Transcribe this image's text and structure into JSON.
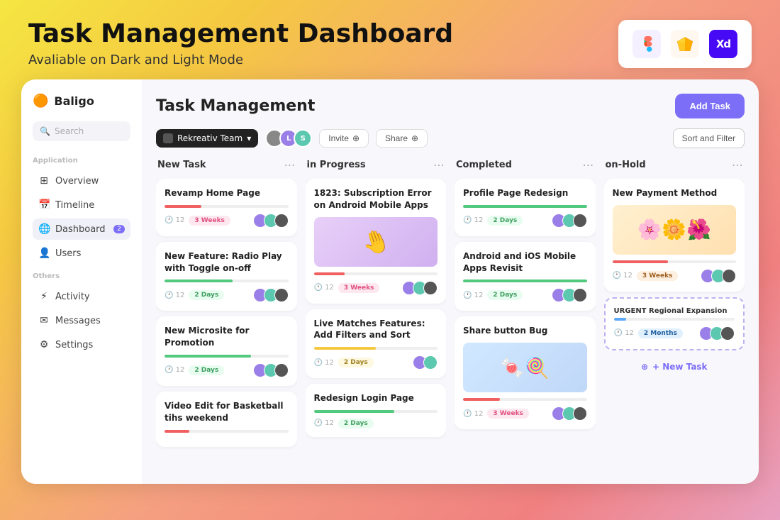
{
  "page": {
    "title": "Task Management Dashboard",
    "subtitle": "Avaliable on Dark and Light Mode"
  },
  "tools": [
    {
      "name": "Figma",
      "emoji": "🎨",
      "class": "tool-figma"
    },
    {
      "name": "Sketch",
      "emoji": "💎",
      "class": "tool-sketch"
    },
    {
      "name": "XD",
      "label": "Xd",
      "class": "tool-xd"
    }
  ],
  "sidebar": {
    "logo": "Baligo",
    "search_placeholder": "Search",
    "app_section": "Application",
    "nav_items_app": [
      {
        "label": "Overview",
        "icon": "⊞"
      },
      {
        "label": "Timeline",
        "icon": "📅"
      },
      {
        "label": "Dashboard",
        "icon": "🌐",
        "badge": "2"
      },
      {
        "label": "Users",
        "icon": "👤"
      }
    ],
    "others_section": "Others",
    "nav_items_others": [
      {
        "label": "Activity",
        "icon": "⚡"
      },
      {
        "label": "Messages",
        "icon": "✉"
      },
      {
        "label": "Settings",
        "icon": "⚙"
      }
    ]
  },
  "main": {
    "title": "Task Management",
    "add_task_label": "Add Task",
    "team_selector": "Rekreativ Team",
    "invite_label": "Invite",
    "share_label": "Share",
    "sort_filter_label": "Sort and Filter"
  },
  "columns": [
    {
      "id": "new-task",
      "title": "New Task",
      "cards": [
        {
          "title": "Revamp Home Page",
          "progress": 30,
          "progress_class": "fill-red",
          "clock_num": 12,
          "badge": "3 Weeks",
          "badge_class": "badge-pink",
          "avatars": [
            "av-purple",
            "av-teal",
            "av-dark"
          ]
        },
        {
          "title": "New Feature: Radio Play with Toggle on-off",
          "progress": 55,
          "progress_class": "fill-green",
          "clock_num": 12,
          "badge": "2 Days",
          "badge_class": "badge-green",
          "avatars": [
            "av-purple",
            "av-teal",
            "av-dark"
          ]
        },
        {
          "title": "New Microsite for Promotion",
          "progress": 70,
          "progress_class": "fill-green",
          "clock_num": 12,
          "badge": "2 Days",
          "badge_class": "badge-green",
          "avatars": [
            "av-purple",
            "av-teal",
            "av-dark"
          ]
        },
        {
          "title": "Video Edit for Basketball tihs weekend",
          "progress": 20,
          "progress_class": "fill-red",
          "clock_num": 12,
          "badge": "2 Days",
          "badge_class": "badge-green",
          "avatars": []
        }
      ]
    },
    {
      "id": "in-progress",
      "title": "in Progress",
      "cards": [
        {
          "title": "1823: Subscription Error on Android Mobile Apps",
          "has_image": true,
          "image_class": "img-purple-hand",
          "progress": 25,
          "progress_class": "fill-red",
          "clock_num": 12,
          "badge": "3 Weeks",
          "badge_class": "badge-pink",
          "avatars": [
            "av-purple",
            "av-teal",
            "av-dark"
          ]
        },
        {
          "title": "Live Matches Features: Add Filters and Sort",
          "progress": 50,
          "progress_class": "fill-yellow",
          "clock_num": 12,
          "badge": "2 Days",
          "badge_class": "badge-yellow",
          "avatars": [
            "av-purple",
            "av-teal"
          ]
        },
        {
          "title": "Redesign Login Page",
          "progress": 65,
          "progress_class": "fill-green",
          "clock_num": 12,
          "badge": "2 Days",
          "badge_class": "badge-green",
          "avatars": []
        }
      ]
    },
    {
      "id": "completed",
      "title": "Completed",
      "cards": [
        {
          "title": "Profile Page Redesign",
          "progress": 100,
          "progress_class": "fill-green",
          "clock_num": 12,
          "badge": "2 Days",
          "badge_class": "badge-green",
          "avatars": [
            "av-purple",
            "av-teal",
            "av-dark"
          ]
        },
        {
          "title": "Android and iOS Mobile Apps Revisit",
          "progress": 100,
          "progress_class": "fill-green",
          "clock_num": 12,
          "badge": "2 Days",
          "badge_class": "badge-green",
          "avatars": [
            "av-purple",
            "av-teal",
            "av-dark"
          ]
        },
        {
          "title": "Share button Bug",
          "has_image": true,
          "image_class": "img-candy",
          "progress": 30,
          "progress_class": "fill-red",
          "clock_num": 12,
          "badge": "3 Weeks",
          "badge_class": "badge-pink",
          "avatars": [
            "av-purple",
            "av-teal",
            "av-dark"
          ]
        }
      ]
    },
    {
      "id": "on-hold",
      "title": "on-Hold",
      "cards": [
        {
          "title": "New Payment Method",
          "has_image": true,
          "image_class": "img-flowers",
          "progress": 45,
          "progress_class": "fill-red",
          "clock_num": 12,
          "badge": "3 Weeks",
          "badge_class": "badge-orange",
          "avatars": [
            "av-purple",
            "av-teal",
            "av-dark"
          ]
        },
        {
          "urgent": true,
          "urgent_label": "URGENT",
          "title": "Regional Expansion",
          "progress": 10,
          "progress_class": "fill-blue",
          "clock_num": 12,
          "badge": "2 Months",
          "badge_class": "badge-blue",
          "avatars": [
            "av-purple",
            "av-teal",
            "av-dark"
          ]
        }
      ],
      "new_task_label": "+ New Task"
    }
  ]
}
